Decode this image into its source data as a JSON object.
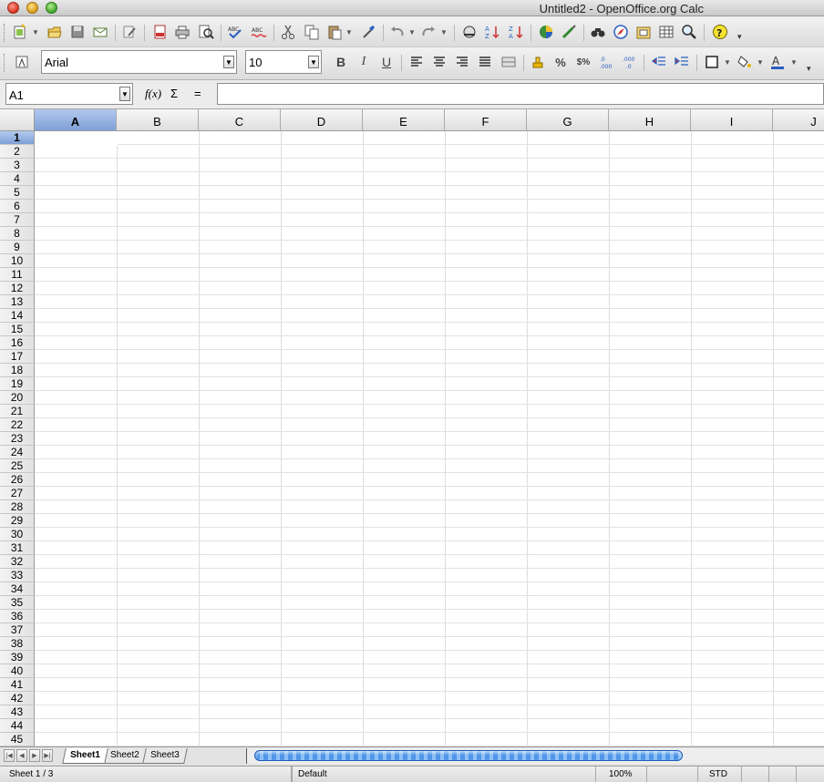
{
  "window": {
    "title": "Untitled2 - OpenOffice.org Calc"
  },
  "toolbar_standard": {
    "icons": [
      "new-icon",
      "open-icon",
      "save-icon",
      "email-icon",
      "edit-file-icon",
      "export-pdf-icon",
      "print-icon",
      "page-preview-icon",
      "spellcheck-icon",
      "autospellcheck-icon",
      "cut-icon",
      "copy-icon",
      "paste-icon",
      "clone-formatting-icon",
      "undo-icon",
      "redo-icon",
      "hyperlink-icon",
      "sort-ascending-icon",
      "sort-descending-icon",
      "chart-icon",
      "draw-functions-icon",
      "find-replace-icon",
      "navigator-icon",
      "gallery-icon",
      "datasources-icon",
      "zoom-icon",
      "help-icon"
    ]
  },
  "toolbar_format": {
    "font_name": "Arial",
    "font_size": "10",
    "bold_label": "B",
    "italic_label": "I",
    "underline_label": "U"
  },
  "formula_bar": {
    "cell_reference": "A1",
    "function_wizard_label": "f(x)",
    "sum_label": "Σ",
    "equals_label": "=",
    "content": ""
  },
  "grid": {
    "columns": [
      "A",
      "B",
      "C",
      "D",
      "E",
      "F",
      "G",
      "H",
      "I",
      "J"
    ],
    "selected_column": "A",
    "rows": [
      "1",
      "2",
      "3",
      "4",
      "5",
      "6",
      "7",
      "8",
      "9",
      "10",
      "11",
      "12",
      "13",
      "14",
      "15",
      "16",
      "17",
      "18",
      "19",
      "20",
      "21",
      "22",
      "23",
      "24",
      "25",
      "26",
      "27",
      "28",
      "29",
      "30",
      "31",
      "32",
      "33",
      "34",
      "35",
      "36",
      "37",
      "38",
      "39",
      "40",
      "41",
      "42",
      "43",
      "44",
      "45"
    ],
    "selected_row": "1"
  },
  "sheets": {
    "tabs": [
      "Sheet1",
      "Sheet2",
      "Sheet3"
    ],
    "active": "Sheet1"
  },
  "statusbar": {
    "sheet_position": "Sheet 1 / 3",
    "page_style": "Default",
    "zoom": "100%",
    "selection_mode": "STD"
  },
  "colors": {
    "selection_header": "#7f9fd6",
    "scrollbar_thumb": "#4f96e8"
  }
}
